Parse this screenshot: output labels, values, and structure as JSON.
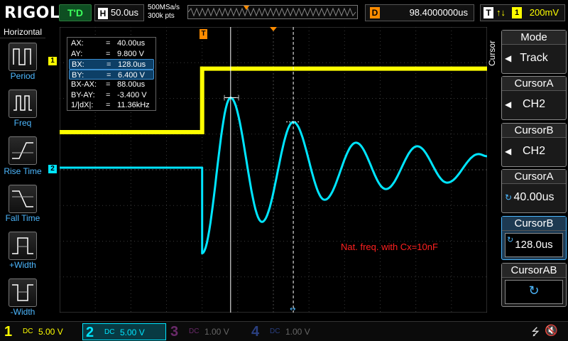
{
  "topbar": {
    "logo": "RIGOL",
    "trigger_status": "T'D",
    "timebase_key": "H",
    "timebase": "50.0us",
    "sample_rate": "500MSa/s",
    "memory_depth": "300k pts",
    "delay_key": "D",
    "delay": "98.4000000us",
    "trigger_key": "T",
    "trigger_edge": "↑↓",
    "trigger_source": "1",
    "trigger_level": "200mV"
  },
  "left_menu": {
    "title": "Horizontal",
    "items": [
      {
        "label": "Period",
        "icon": "period-icon"
      },
      {
        "label": "Freq",
        "icon": "freq-icon"
      },
      {
        "label": "Rise Time",
        "icon": "rise-time-icon"
      },
      {
        "label": "Fall Time",
        "icon": "fall-time-icon"
      },
      {
        "label": "+Width",
        "icon": "positive-width-icon"
      },
      {
        "label": "-Width",
        "icon": "negative-width-icon"
      }
    ]
  },
  "readout": {
    "rows": [
      {
        "key": "AX:",
        "eq": "=",
        "value": "40.00us",
        "highlight": false
      },
      {
        "key": "AY:",
        "eq": "=",
        "value": "9.800 V",
        "highlight": false
      },
      {
        "key": "BX:",
        "eq": "=",
        "value": "128.0us",
        "highlight": true
      },
      {
        "key": "BY:",
        "eq": "=",
        "value": "6.400 V",
        "highlight": true
      },
      {
        "key": "BX-AX:",
        "eq": "=",
        "value": "88.00us",
        "highlight": false
      },
      {
        "key": "BY-AY:",
        "eq": "=",
        "value": "-3.400 V",
        "highlight": false
      },
      {
        "key": "1/|dX|:",
        "eq": "=",
        "value": "11.36kHz",
        "highlight": false
      }
    ]
  },
  "annotation": "Nat. freq. with Cx=10nF",
  "right_menu": {
    "title": "Cursor",
    "mode": {
      "header": "Mode",
      "value": "Track"
    },
    "cursor_a_source": {
      "header": "CursorA",
      "value": "CH2"
    },
    "cursor_b_source": {
      "header": "CursorB",
      "value": "CH2"
    },
    "cursor_a_pos": {
      "header": "CursorA",
      "value": "40.00us"
    },
    "cursor_b_pos": {
      "header": "CursorB",
      "value": "128.0us"
    },
    "cursor_ab": {
      "header": "CursorAB",
      "value": "↻"
    }
  },
  "channels": [
    {
      "num": "1",
      "coupling": "DC",
      "scale": "5.00 V",
      "color": "#ffff00",
      "active": false
    },
    {
      "num": "2",
      "coupling": "DC",
      "scale": "5.00 V",
      "color": "#00e5ff",
      "active": true
    },
    {
      "num": "3",
      "coupling": "DC",
      "scale": "1.00 V",
      "color": "#cc44cc",
      "active": false
    },
    {
      "num": "4",
      "coupling": "DC",
      "scale": "1.00 V",
      "color": "#3a6bff",
      "active": false
    }
  ],
  "colors": {
    "ch1": "#ffff00",
    "ch2": "#00e5ff",
    "annotation": "#ff2020",
    "accent": "#4db8ff",
    "trigger_marker": "#ff8c00"
  },
  "chart_data": {
    "type": "line",
    "x_unit": "us",
    "y_unit": "V",
    "xlim": [
      -200,
      400
    ],
    "series": [
      {
        "name": "CH1",
        "color": "#ffff00",
        "points": [
          [
            -200,
            0
          ],
          [
            0,
            0
          ],
          [
            0,
            5
          ],
          [
            400,
            5
          ]
        ]
      },
      {
        "name": "CH2",
        "color": "#00e5ff",
        "points": [
          [
            -200,
            0
          ],
          [
            0,
            0
          ],
          [
            0,
            -12
          ],
          [
            40,
            9.8
          ],
          [
            84,
            -7.6
          ],
          [
            128,
            6.4
          ],
          [
            172,
            -4.5
          ],
          [
            216,
            3.5
          ],
          [
            258,
            -3
          ],
          [
            302,
            3
          ],
          [
            344,
            -2.1
          ],
          [
            388,
            1.9
          ],
          [
            400,
            1.6
          ]
        ]
      }
    ],
    "cursor_a": {
      "x": 40,
      "y": 9.8
    },
    "cursor_b": {
      "x": 128,
      "y": 6.4
    }
  }
}
